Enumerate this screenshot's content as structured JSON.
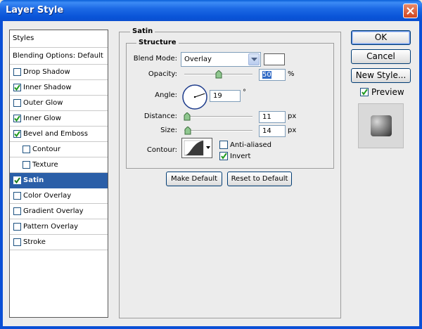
{
  "window": {
    "title": "Layer Style"
  },
  "styles_panel": {
    "header": "Styles",
    "blending": "Blending Options: Default",
    "items": [
      {
        "label": "Drop Shadow",
        "checked": false,
        "indent": false,
        "selected": false
      },
      {
        "label": "Inner Shadow",
        "checked": true,
        "indent": false,
        "selected": false
      },
      {
        "label": "Outer Glow",
        "checked": false,
        "indent": false,
        "selected": false
      },
      {
        "label": "Inner Glow",
        "checked": true,
        "indent": false,
        "selected": false
      },
      {
        "label": "Bevel and Emboss",
        "checked": true,
        "indent": false,
        "selected": false
      },
      {
        "label": "Contour",
        "checked": false,
        "indent": true,
        "selected": false
      },
      {
        "label": "Texture",
        "checked": false,
        "indent": true,
        "selected": false
      },
      {
        "label": "Satin",
        "checked": true,
        "indent": false,
        "selected": true
      },
      {
        "label": "Color Overlay",
        "checked": false,
        "indent": false,
        "selected": false
      },
      {
        "label": "Gradient Overlay",
        "checked": false,
        "indent": false,
        "selected": false
      },
      {
        "label": "Pattern Overlay",
        "checked": false,
        "indent": false,
        "selected": false
      },
      {
        "label": "Stroke",
        "checked": false,
        "indent": false,
        "selected": false
      }
    ]
  },
  "satin": {
    "title": "Satin",
    "structure_title": "Structure",
    "blend_mode_label": "Blend Mode:",
    "blend_mode_value": "Overlay",
    "blend_color": "#ffffff",
    "opacity_label": "Opacity:",
    "opacity_value": "50",
    "opacity_unit": "%",
    "opacity_fraction": 0.5,
    "angle_label": "Angle:",
    "angle_value": "19",
    "angle_unit": "°",
    "distance_label": "Distance:",
    "distance_value": "11",
    "distance_unit": "px",
    "distance_fraction": 0.04,
    "size_label": "Size:",
    "size_value": "14",
    "size_unit": "px",
    "size_fraction": 0.05,
    "contour_label": "Contour:",
    "anti_aliased_label": "Anti-aliased",
    "anti_aliased_checked": false,
    "invert_label": "Invert",
    "invert_checked": true,
    "make_default_label": "Make Default",
    "reset_default_label": "Reset to Default"
  },
  "side_buttons": {
    "ok_label": "OK",
    "cancel_label": "Cancel",
    "new_style_label": "New Style...",
    "preview_label": "Preview",
    "preview_checked": true
  },
  "colors": {
    "titlebar": "#0a5fd8",
    "selected_row": "#2b5fa8",
    "checkmark": "#1f9a1f"
  }
}
